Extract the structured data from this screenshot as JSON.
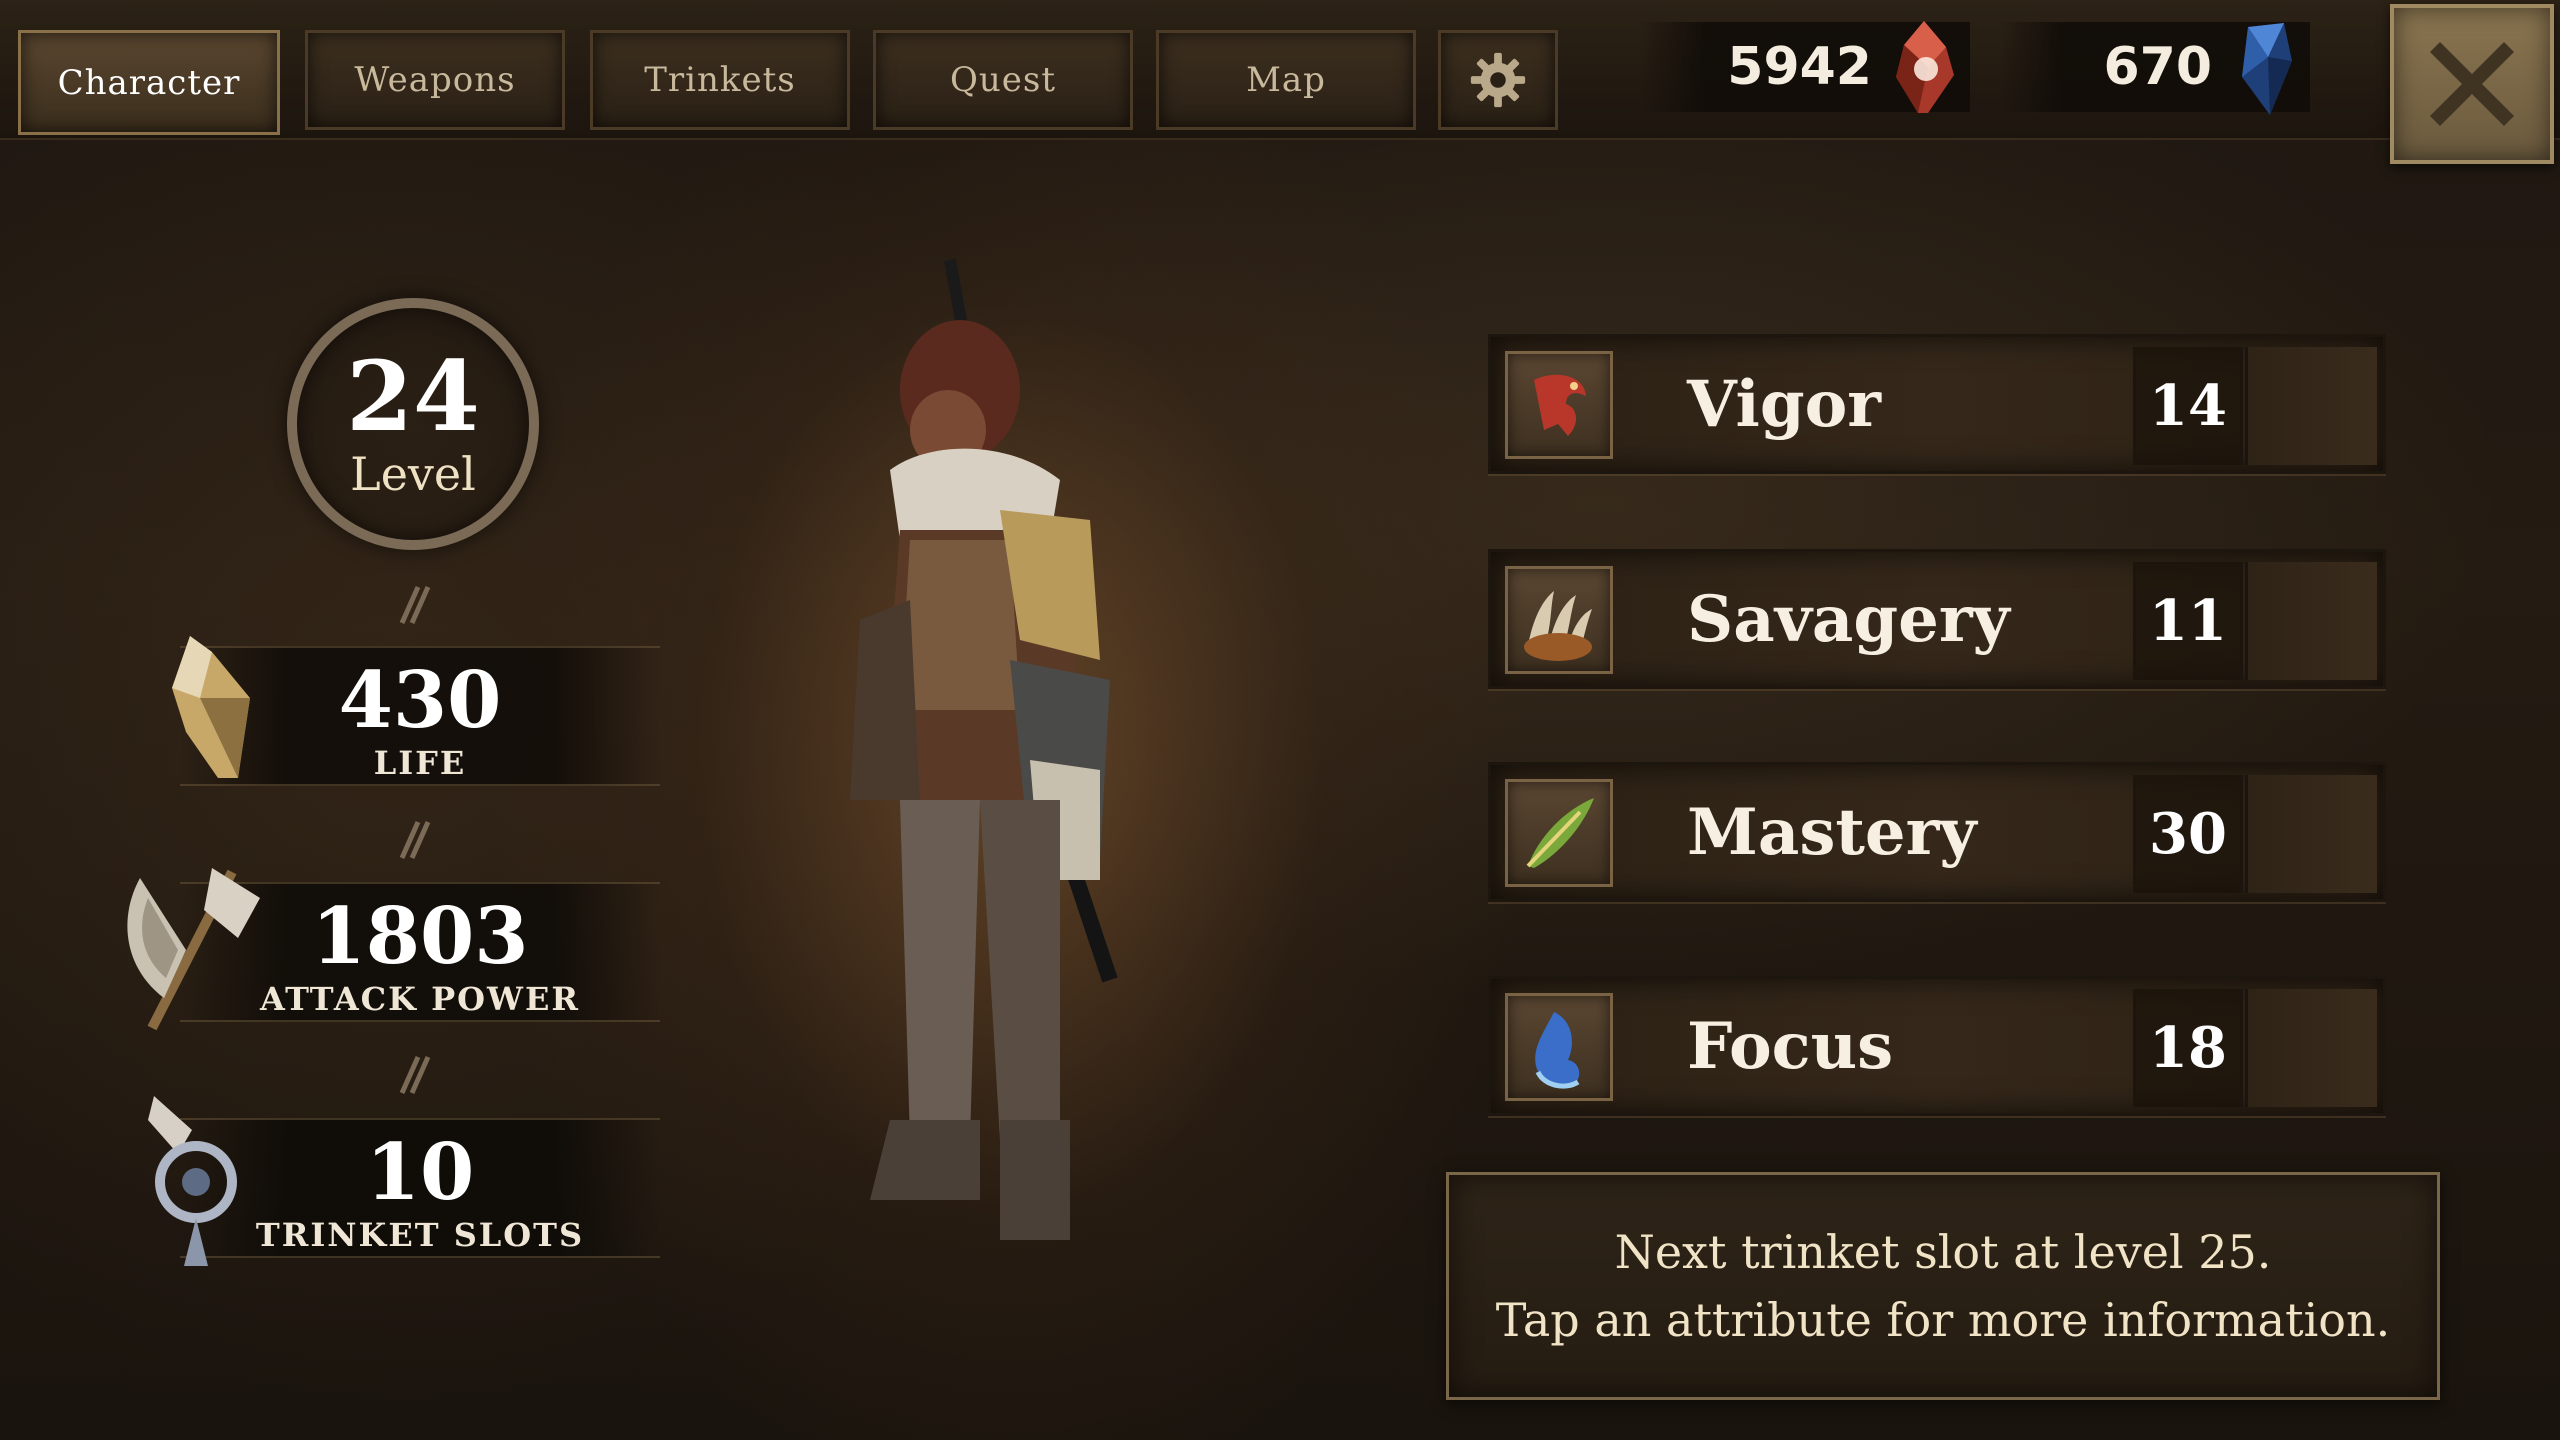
{
  "tabs": [
    {
      "label": "Character",
      "active": true
    },
    {
      "label": "Weapons",
      "active": false
    },
    {
      "label": "Trinkets",
      "active": false
    },
    {
      "label": "Quest",
      "active": false
    },
    {
      "label": "Map",
      "active": false
    }
  ],
  "settings_icon": "gear-icon",
  "currency": {
    "red": {
      "amount": "5942",
      "icon": "red-gem-icon",
      "color": "#c2412f"
    },
    "blue": {
      "amount": "670",
      "icon": "blue-crystal-icon",
      "color": "#2a5ea8"
    }
  },
  "close_icon": "close-x-icon",
  "level": {
    "value": "24",
    "label": "Level"
  },
  "stats": [
    {
      "value": "430",
      "label": "LIFE",
      "icon": "life-shield-icon"
    },
    {
      "value": "1803",
      "label": "ATTACK POWER",
      "icon": "battle-axe-icon"
    },
    {
      "value": "10",
      "label": "TRINKET SLOTS",
      "icon": "trinket-pendant-icon"
    }
  ],
  "attributes": [
    {
      "name": "Vigor",
      "value": "14",
      "icon": "vigor-dragon-icon",
      "color": "#b8362a"
    },
    {
      "name": "Savagery",
      "value": "11",
      "icon": "savagery-claw-icon",
      "color": "#c98a3a"
    },
    {
      "name": "Mastery",
      "value": "30",
      "icon": "mastery-feather-icon",
      "color": "#7aa83a"
    },
    {
      "name": "Focus",
      "value": "18",
      "icon": "focus-spirit-icon",
      "color": "#3a6ec8"
    }
  ],
  "info": {
    "line1": "Next trinket slot at level 25.",
    "line2": "Tap an attribute for more information."
  }
}
